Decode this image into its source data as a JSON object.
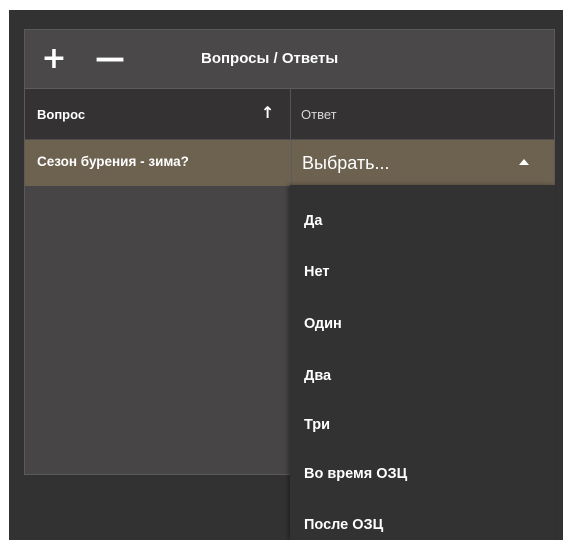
{
  "toolbar": {
    "add_label": "+",
    "remove_label": "—",
    "title": "Вопросы / Ответы"
  },
  "columns": {
    "question": "Вопрос",
    "answer": "Ответ",
    "sort_icon": "↑"
  },
  "rows": [
    {
      "question": "Сезон бурения - зима?",
      "answer_placeholder": "Выбрать..."
    }
  ],
  "dropdown": {
    "options": [
      "Да",
      "Нет",
      "Один",
      "Два",
      "Три",
      "Во время ОЗЦ",
      "После ОЗЦ"
    ]
  },
  "colors": {
    "selected_row": "#6d6150",
    "panel": "#474546",
    "background": "#333233"
  },
  "icons": {
    "add": "plus-icon",
    "remove": "minus-icon",
    "sort": "arrow-up-icon",
    "dropdown": "caret-up-icon"
  }
}
